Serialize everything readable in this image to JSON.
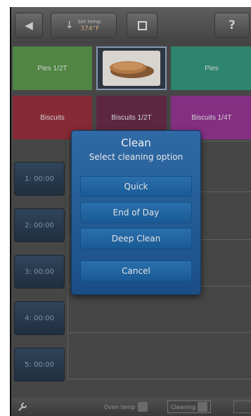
{
  "topbar": {
    "setpoint_label": "Set temp:",
    "setpoint_value": "374°F",
    "help_label": "?"
  },
  "tiles": [
    {
      "label": "Pies 1/2T",
      "color": "#4a8a3b"
    },
    {
      "label": "",
      "color": "#1f2a3a",
      "image": "biscuit-photo"
    },
    {
      "label": "Pies",
      "color": "#1f8a6e"
    },
    {
      "label": "Biscuits",
      "color": "#8c1b2a"
    },
    {
      "label": "Biscuits 1/2T",
      "color": "#5a1839"
    },
    {
      "label": "Biscuits 1/4T",
      "color": "#8a2288"
    }
  ],
  "timers": [
    "1: 00:00",
    "2: 00:00",
    "3: 00:00",
    "4: 00:00",
    "5: 00:00"
  ],
  "bottombar": {
    "oven_temp_label": "Oven temp",
    "cleaning_label": "Cleaning"
  },
  "dialog": {
    "title": "Clean",
    "subtitle": "Select cleaning option",
    "options": [
      "Quick",
      "End of Day",
      "Deep Clean"
    ],
    "cancel": "Cancel"
  },
  "colors": {
    "dialog_bg": "#2466a0",
    "timer_bg": "#1a3049",
    "screen_bg": "#3e3e3e"
  }
}
